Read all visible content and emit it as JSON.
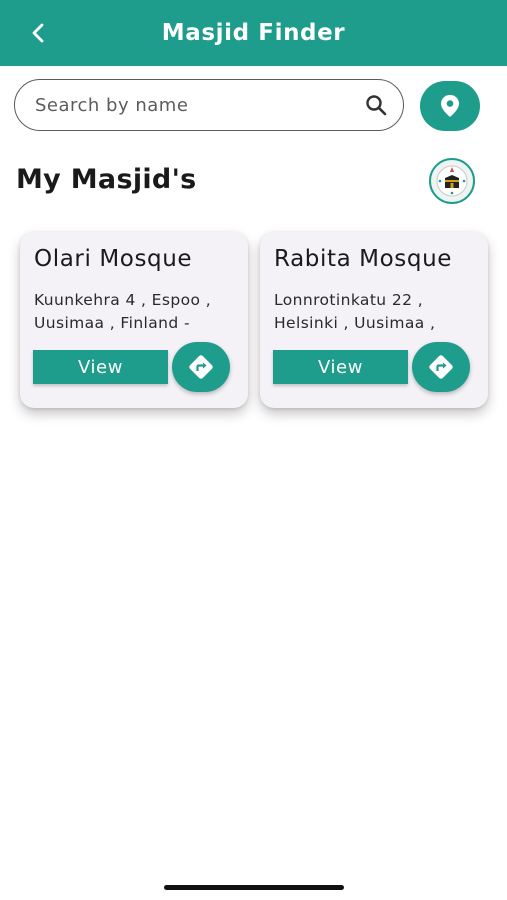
{
  "header": {
    "title": "Masjid Finder",
    "back_icon": "chevron-left-icon",
    "background_color": "#1e9c8c"
  },
  "search": {
    "placeholder": "Search by name",
    "value": "",
    "icon": "search-icon"
  },
  "location_button": {
    "icon": "location-pin-icon"
  },
  "section": {
    "title": "My Masjid's",
    "qibla_icon": "kaaba-compass-icon"
  },
  "masjids": [
    {
      "name": "Olari Mosque",
      "address": "Kuunkehra 4 , Espoo , Uusimaa , Finland -",
      "view_label": "View",
      "directions_icon": "directions-icon"
    },
    {
      "name": "Rabita Mosque",
      "address": "Lonnrotinkatu 22 , Helsinki , Uusimaa ,",
      "view_label": "View",
      "directions_icon": "directions-icon"
    }
  ],
  "colors": {
    "accent": "#1e9c8c",
    "card_background": "#f4f1f7",
    "text": "#1a1a1a"
  }
}
